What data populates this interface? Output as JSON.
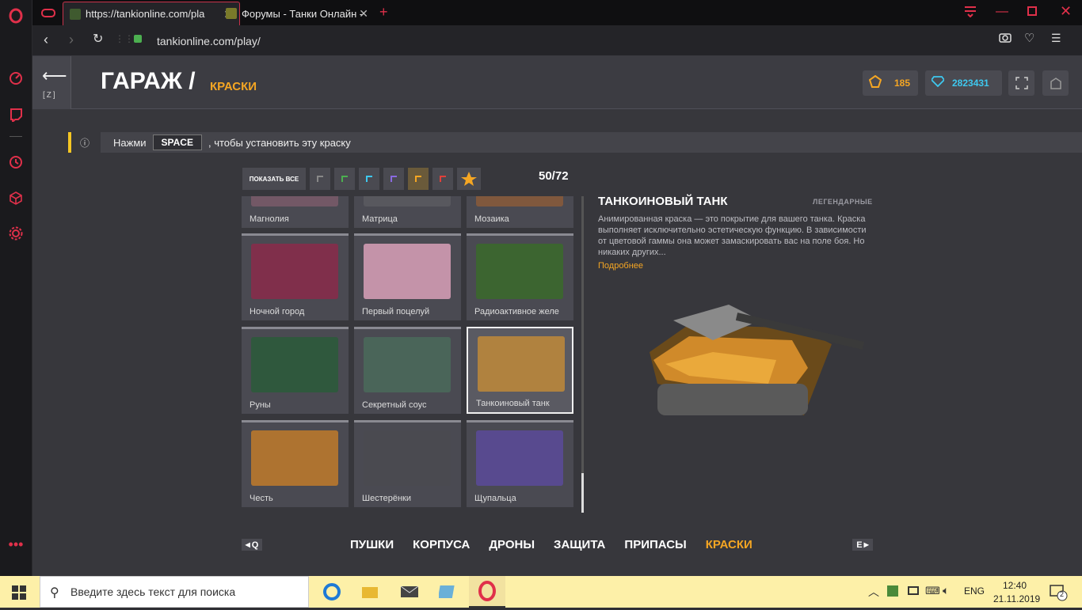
{
  "browser": {
    "tabs": [
      {
        "title": "https://tankionline.com/pla"
      },
      {
        "title": "Форумы - Танки Онлайн -"
      }
    ],
    "new_tab": "+",
    "url": "tankionline.com/play/"
  },
  "game": {
    "back_key": "[Z]",
    "title": "ГАРАЖ /",
    "subtitle": "КРАСКИ",
    "crystals_label": "185",
    "diamonds_label": "2823431",
    "hint": {
      "pre": "Нажми",
      "key": "SPACE",
      "post": ", чтобы установить эту краску"
    },
    "show_all": "ПОКАЗАТЬ ВСЕ",
    "counter": "50/72",
    "paints": [
      {
        "name": "Магнолия",
        "color": "#7a5a6a"
      },
      {
        "name": "Матрица",
        "color": "#5a5a60"
      },
      {
        "name": "Мозаика",
        "color": "#8a5a3a"
      },
      {
        "name": "Ночной город",
        "color": "#8a2a4a"
      },
      {
        "name": "Первый поцелуй",
        "color": "#d9a0b8"
      },
      {
        "name": "Радиоактивное желе",
        "color": "#3a6a2a"
      },
      {
        "name": "Руны",
        "color": "#2a5a3a"
      },
      {
        "name": "Секретный соус",
        "color": "#4a6a5a"
      },
      {
        "name": "Танкоиновый танк",
        "color": "#c08a3a"
      },
      {
        "name": "Честь",
        "color": "#c07a2a"
      },
      {
        "name": "Шестерёнки",
        "color": "#4a4a50"
      },
      {
        "name": "Щупальца",
        "color": "#5a4a9a"
      }
    ],
    "detail": {
      "title": "ТАНКОИНОВЫЙ ТАНК",
      "rarity": "ЛЕГЕНДАРНЫЕ",
      "desc": "Анимированная краска — это покрытие для вашего танка. Краска выполняет исключительно эстетическую функцию. В зависимости от цветовой гаммы она может замаскировать вас на поле боя. Но никаких других...",
      "more": "Подробнее"
    },
    "nav": {
      "prev_key": "Q",
      "next_key": "E",
      "items": [
        "ПУШКИ",
        "КОРПУСА",
        "ДРОНЫ",
        "ЗАЩИТА",
        "ПРИПАСЫ",
        "КРАСКИ"
      ]
    }
  },
  "taskbar": {
    "search_placeholder": "Введите здесь текст для поиска",
    "lang": "ENG",
    "time": "12:40",
    "date": "21.11.2019",
    "notif_count": "2"
  }
}
